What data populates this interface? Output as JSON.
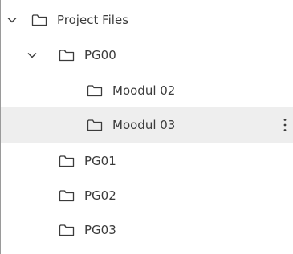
{
  "tree": {
    "root": {
      "label": "Project Files",
      "icon": "folder-icon",
      "expanded": true
    },
    "group": {
      "label": "PG00",
      "icon": "folder-icon",
      "expanded": true
    },
    "modules": [
      {
        "label": "Moodul 02",
        "icon": "folder-icon",
        "selected": false
      },
      {
        "label": "Moodul 03",
        "icon": "folder-icon",
        "selected": true,
        "menu_icon": "more-vertical-icon"
      }
    ],
    "siblings": [
      {
        "label": "PG01",
        "icon": "folder-icon"
      },
      {
        "label": "PG02",
        "icon": "folder-icon"
      },
      {
        "label": "PG03",
        "icon": "folder-icon"
      }
    ]
  },
  "colors": {
    "text": "#3b3b3b",
    "selected_row_bg": "#eeeeee",
    "border": "#9a9a9a"
  }
}
